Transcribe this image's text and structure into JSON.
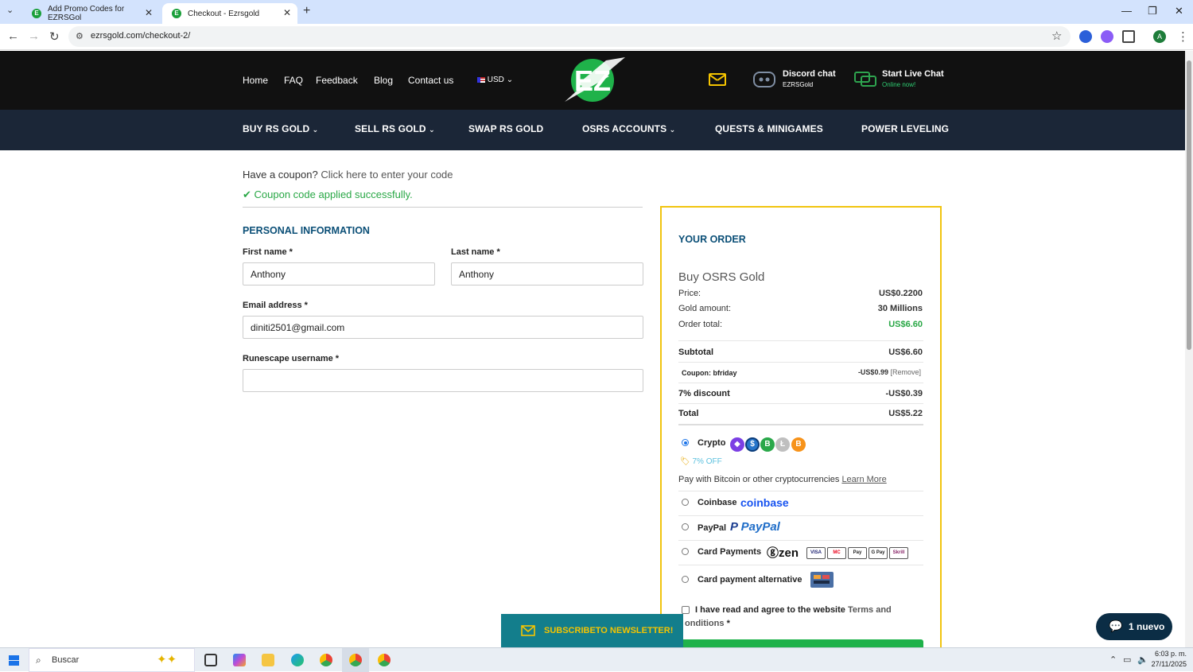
{
  "browser": {
    "tabs": [
      {
        "title": "Add Promo Codes for EZRSGol"
      },
      {
        "title": "Checkout - Ezrsgold"
      }
    ],
    "url": "ezrsgold.com/checkout-2/"
  },
  "header": {
    "nav": [
      "Home",
      "FAQ",
      "Feedback",
      "Blog",
      "Contact us"
    ],
    "currency": "USD",
    "logo_text": "EZ",
    "discord": {
      "title": "Discord chat",
      "sub": "EZRSGold"
    },
    "livechat": {
      "title": "Start Live Chat",
      "sub": "Online now!"
    }
  },
  "menu": [
    "BUY RS GOLD",
    "SELL RS GOLD",
    "SWAP RS GOLD",
    "OSRS ACCOUNTS",
    "QUESTS & MINIGAMES",
    "POWER LEVELING"
  ],
  "coupon": {
    "question": "Have a coupon?",
    "link": "Click here to enter your code",
    "success": "Coupon code applied successfully."
  },
  "form": {
    "section_title": "PERSONAL INFORMATION",
    "first_name_label": "First name *",
    "first_name_value": "Anthony",
    "last_name_label": "Last name *",
    "last_name_value": "Anthony",
    "email_label": "Email address *",
    "email_value": "diniti2501@gmail.com",
    "username_label": "Runescape username *",
    "username_value": ""
  },
  "order": {
    "title": "YOUR ORDER",
    "product": "Buy OSRS Gold",
    "price_label": "Price:",
    "price_value": "US$0.2200",
    "gold_label": "Gold amount:",
    "gold_value": "30 Millions",
    "total_label": "Order total:",
    "total_value": "US$6.60",
    "subtotal_label": "Subtotal",
    "subtotal_value": "US$6.60",
    "coupon_label": "Coupon: bfriday",
    "coupon_value": "-US$0.99",
    "coupon_remove": "[Remove]",
    "discount_label": "7% discount",
    "discount_value": "-US$0.39",
    "grand_label": "Total",
    "grand_value": "US$5.22"
  },
  "payment": {
    "crypto_label": "Crypto",
    "crypto_off": "7% OFF",
    "crypto_desc": "Pay with Bitcoin or other cryptocurrencies",
    "learn_more": "Learn More",
    "coinbase_label": "Coinbase",
    "coinbase_logo": "coinbase",
    "paypal_label": "PayPal",
    "paypal_logo": "PayPal",
    "card_label": "Card Payments",
    "zen_logo": "zen",
    "cards": [
      "VISA",
      "MC",
      "Pay",
      "G Pay",
      "Skrill"
    ],
    "alt_label": "Card payment alternative",
    "terms_text": "I have read and agree to the website",
    "terms_link": "Terms and",
    "terms_link2": "onditions",
    "terms_star": "*"
  },
  "newsletter": "SUBSCRIBETO NEWSLETTER!",
  "chat_widget": "1 nuevo",
  "taskbar": {
    "search": "Buscar",
    "time": "6:03 p. m.",
    "date": "27/11/2025"
  },
  "colors": {
    "success_green": "#28a745",
    "order_border": "#f1c40f",
    "menu_bg": "#1b2637",
    "title_blue": "#0b4f77"
  }
}
